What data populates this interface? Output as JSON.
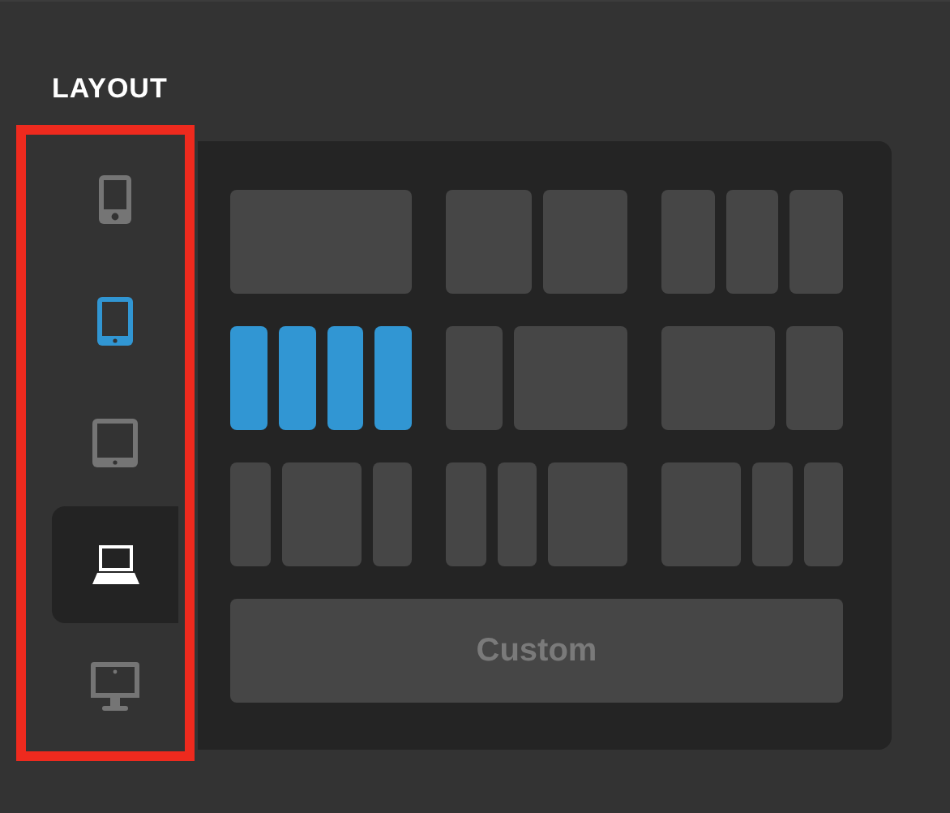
{
  "title": "LAYOUT",
  "devices": [
    {
      "kind": "phone",
      "selected": false,
      "highlighted": false
    },
    {
      "kind": "tablet-portrait",
      "selected": false,
      "highlighted": true
    },
    {
      "kind": "tablet-landscape",
      "selected": false,
      "highlighted": false
    },
    {
      "kind": "laptop",
      "selected": true,
      "highlighted": false
    },
    {
      "kind": "desktop",
      "selected": false,
      "highlighted": false
    }
  ],
  "layouts": [
    {
      "kind": "full",
      "selected": false
    },
    {
      "kind": "halves",
      "selected": false
    },
    {
      "kind": "thirds",
      "selected": false
    },
    {
      "kind": "quarters",
      "selected": true
    },
    {
      "kind": "narrow-wide",
      "selected": false
    },
    {
      "kind": "wide-narrow",
      "selected": false
    },
    {
      "kind": "centered",
      "selected": false
    },
    {
      "kind": "narrow-narrow-wide",
      "selected": false
    },
    {
      "kind": "wide-narrow-narrow",
      "selected": false
    }
  ],
  "custom_button": "Custom"
}
